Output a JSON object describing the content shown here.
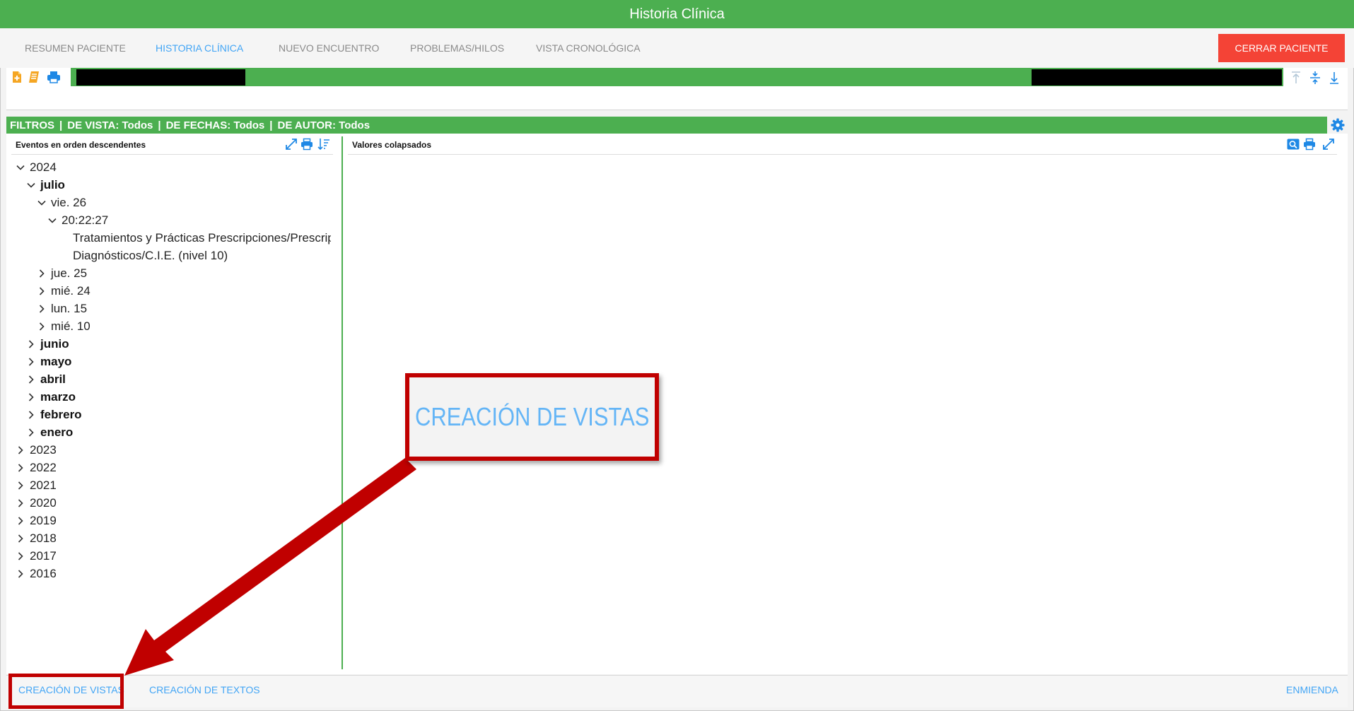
{
  "window": {
    "title": "Historia Clínica"
  },
  "nav": {
    "tabs": [
      {
        "label": "RESUMEN PACIENTE"
      },
      {
        "label": "HISTORIA CLÍNICA",
        "active": true
      },
      {
        "label": "NUEVO ENCUENTRO"
      },
      {
        "label": "PROBLEMAS/HILOS"
      },
      {
        "label": "VISTA CRONOLÓGICA"
      }
    ],
    "close_label": "CERRAR PACIENTE"
  },
  "filters": {
    "label": "FILTROS",
    "view": "DE VISTA: Todos",
    "date": "DE FECHAS: Todos",
    "author": "DE AUTOR: Todos",
    "separator": "|"
  },
  "left_panel": {
    "title": "Eventos en orden descendentes"
  },
  "right_panel": {
    "title": "Valores colapsados"
  },
  "tree": [
    {
      "label": "2024",
      "expanded": true
    },
    {
      "label": "julio",
      "expanded": true
    },
    {
      "label": "vie. 26",
      "expanded": true
    },
    {
      "label": "20:22:27",
      "expanded": true
    },
    {
      "label": "Tratamientos y Prácticas Prescripciones/Prescripciones"
    },
    {
      "label": "Diagnósticos/C.I.E. (nivel 10)"
    },
    {
      "label": "jue. 25"
    },
    {
      "label": "mié. 24"
    },
    {
      "label": "lun. 15"
    },
    {
      "label": "mié. 10"
    },
    {
      "label": "junio"
    },
    {
      "label": "mayo"
    },
    {
      "label": "abril"
    },
    {
      "label": "marzo"
    },
    {
      "label": "febrero"
    },
    {
      "label": "enero"
    },
    {
      "label": "2023"
    },
    {
      "label": "2022"
    },
    {
      "label": "2021"
    },
    {
      "label": "2020"
    },
    {
      "label": "2019"
    },
    {
      "label": "2018"
    },
    {
      "label": "2017"
    },
    {
      "label": "2016"
    }
  ],
  "bottom": {
    "views_label": "CREACIÓN DE VISTAS",
    "texts_label": "CREACIÓN DE TEXTOS",
    "amend_label": "ENMIENDA"
  },
  "callout": {
    "text": "CREACIÓN DE VISTAS"
  },
  "colors": {
    "green": "#4caf50",
    "blue": "#42a5f5",
    "red": "#f44336",
    "highlight": "#c00000",
    "orange": "#f5a623"
  },
  "icons": {
    "toolbar_left": [
      "add-document-icon",
      "notes-icon",
      "printer-icon"
    ],
    "toolbar_right": [
      "collapse-up-icon",
      "split-icon",
      "download-icon"
    ],
    "left_panel": [
      "expand-icon",
      "printer-icon",
      "sort-descending-icon"
    ],
    "right_panel": [
      "search-icon",
      "printer-icon",
      "expand-icon"
    ],
    "filters": "gear-icon"
  }
}
